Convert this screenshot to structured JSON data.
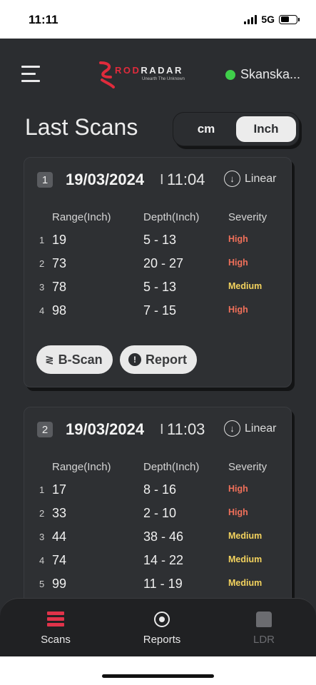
{
  "status_bar": {
    "time": "11:11",
    "network": "5G"
  },
  "header": {
    "logo_prefix": "ROD",
    "logo_suffix": "RADAR",
    "logo_tagline": "Unearth The Unknown",
    "user_name": "Skanska...",
    "status_color": "#3fcf4a"
  },
  "title": "Last Scans",
  "unit_toggle": {
    "option_cm": "cm",
    "option_inch": "Inch",
    "selected": "Inch"
  },
  "columns": {
    "range": "Range(Inch)",
    "depth": "Depth(Inch)",
    "severity": "Severity"
  },
  "scans": [
    {
      "index": "1",
      "date": "19/03/2024",
      "separator": "I",
      "time": "11:04",
      "mode": "Linear",
      "rows": [
        {
          "n": "1",
          "range": "19",
          "depth": "5 - 13",
          "severity": "High"
        },
        {
          "n": "2",
          "range": "73",
          "depth": "20 - 27",
          "severity": "High"
        },
        {
          "n": "3",
          "range": "78",
          "depth": "5 - 13",
          "severity": "Medium"
        },
        {
          "n": "4",
          "range": "98",
          "depth": "7 - 15",
          "severity": "High"
        }
      ],
      "bscan_label": "B-Scan",
      "report_label": "Report"
    },
    {
      "index": "2",
      "date": "19/03/2024",
      "separator": "I",
      "time": "11:03",
      "mode": "Linear",
      "rows": [
        {
          "n": "1",
          "range": "17",
          "depth": "8 - 16",
          "severity": "High"
        },
        {
          "n": "2",
          "range": "33",
          "depth": "2 - 10",
          "severity": "High"
        },
        {
          "n": "3",
          "range": "44",
          "depth": "38 - 46",
          "severity": "Medium"
        },
        {
          "n": "4",
          "range": "74",
          "depth": "14 - 22",
          "severity": "Medium"
        },
        {
          "n": "5",
          "range": "99",
          "depth": "11 - 19",
          "severity": "Medium"
        }
      ]
    }
  ],
  "colors": {
    "high": "#f0705a",
    "medium": "#f4d35e",
    "accent": "#e0334a"
  },
  "bottom_nav": {
    "scans": "Scans",
    "reports": "Reports",
    "ldr": "LDR",
    "active": "Scans"
  }
}
